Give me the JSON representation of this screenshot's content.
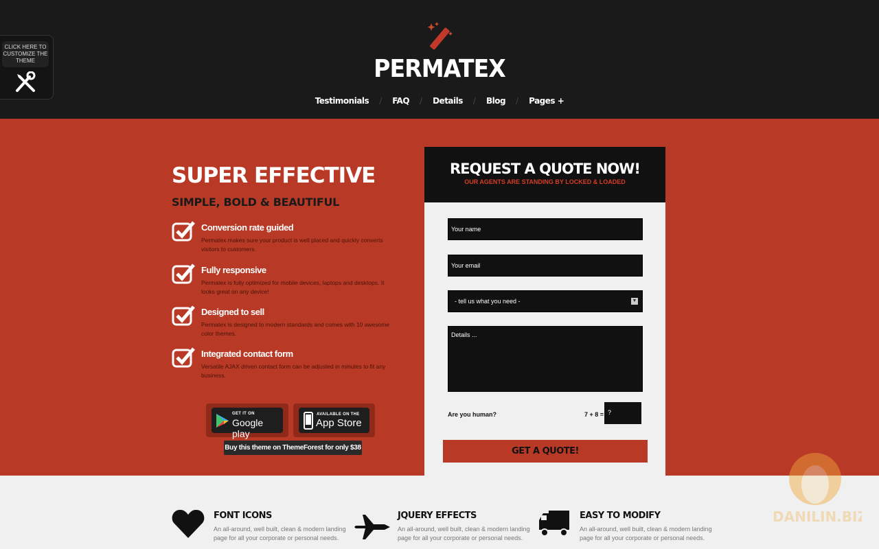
{
  "header": {
    "logo": "PERMATEX",
    "nav": [
      {
        "label": "Testimonials"
      },
      {
        "label": "FAQ"
      },
      {
        "label": "Details"
      },
      {
        "label": "Blog"
      },
      {
        "label": "Pages +"
      }
    ]
  },
  "customizer": {
    "label": "CLICK HERE TO CUSTOMIZE THE THEME",
    "icon": "tools-icon"
  },
  "hero": {
    "title": "SUPER EFFECTIVE",
    "subtitle": "SIMPLE, BOLD & BEAUTIFUL",
    "features": [
      {
        "title": "Conversion rate guided",
        "desc": "Permatex makes sure your product is well placed and quickly converts visitors to customers."
      },
      {
        "title": "Fully responsive",
        "desc": "Permatex is fully optimized for mobile devices, laptops and desktops. It looks great on any device!"
      },
      {
        "title": "Designed to sell",
        "desc": "Permatex is designed to modern standards and comes with 10 awesome color themes."
      },
      {
        "title": "Integrated contact form",
        "desc": "Versatile AJAX driven contact form can be adjusted in minutes to fit any business."
      }
    ],
    "google": {
      "small": "GET IT ON",
      "big": "Google play"
    },
    "apple": {
      "small": "AVAILABLE ON THE",
      "big": "App Store"
    },
    "themeforest": "Buy this theme on ThemeForest for only $38"
  },
  "form": {
    "title": "REQUEST A QUOTE NOW!",
    "subtitle": "OUR AGENTS ARE STANDING BY LOCKED & LOADED",
    "name_placeholder": "Your name",
    "email_placeholder": "Your email",
    "select_value": "- tell us what you need -",
    "details_placeholder": "Details ...",
    "human_label": "Are you human?",
    "equation": "7 + 8 =",
    "answer_placeholder": "?",
    "submit": "GET A QUOTE!"
  },
  "benefits": [
    {
      "title": "FONT ICONS",
      "desc": "An all-around, well built, clean & modern landing page for all your corporate or personal needs.",
      "icon": "heart-icon"
    },
    {
      "title": "JQUERY EFFECTS",
      "desc": "An all-around, well built, clean & modern landing page for all your corporate or personal needs.",
      "icon": "jet-icon"
    },
    {
      "title": "EASY TO MODIFY",
      "desc": "An all-around, well built, clean & modern landing page for all your corporate or personal needs.",
      "icon": "truck-icon"
    }
  ],
  "watermark": "DANILIN.BIZ",
  "colors": {
    "accent": "#b83a26",
    "dark": "#1a1a1a",
    "light": "#f0f0f0"
  }
}
